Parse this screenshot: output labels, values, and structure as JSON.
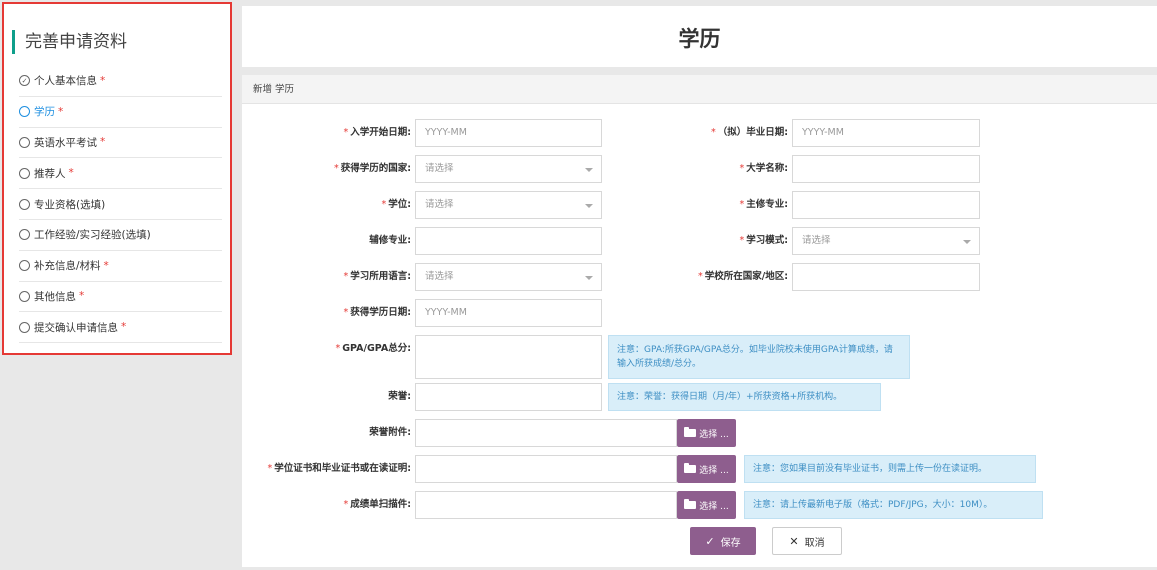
{
  "sidebar": {
    "title": "完善申请资料",
    "items": [
      {
        "label": "个人基本信息",
        "required": "*",
        "mark": "✓"
      },
      {
        "label": "学历",
        "required": "*",
        "mark": ""
      },
      {
        "label": "英语水平考试",
        "required": "*",
        "mark": ""
      },
      {
        "label": "推荐人",
        "required": "*",
        "mark": ""
      },
      {
        "label": "专业资格(选填)",
        "required": "",
        "mark": ""
      },
      {
        "label": "工作经验/实习经验(选填)",
        "required": "",
        "mark": ""
      },
      {
        "label": "补充信息/材料",
        "required": "*",
        "mark": ""
      },
      {
        "label": "其他信息",
        "required": "*",
        "mark": ""
      },
      {
        "label": "提交确认申请信息",
        "required": "*",
        "mark": ""
      }
    ]
  },
  "header": {
    "title": "学历"
  },
  "form": {
    "section_title": "新增 学历",
    "required_mark": "*",
    "fields": {
      "start_date": {
        "label": "入学开始日期:",
        "placeholder": "YYYY-MM"
      },
      "grad_date": {
        "label": "（拟）毕业日期:",
        "placeholder": "YYYY-MM"
      },
      "country": {
        "label": "获得学历的国家:",
        "value": "请选择"
      },
      "university": {
        "label": "大学名称:",
        "value": ""
      },
      "degree": {
        "label": "学位:",
        "value": "请选择"
      },
      "major": {
        "label": "主修专业:",
        "value": ""
      },
      "minor": {
        "label": "辅修专业:",
        "value": ""
      },
      "study_mode": {
        "label": "学习模式:",
        "value": "请选择"
      },
      "language": {
        "label": "学习所用语言:",
        "value": "请选择"
      },
      "school_region": {
        "label": "学校所在国家/地区:",
        "value": ""
      },
      "award_date": {
        "label": "获得学历日期:",
        "placeholder": "YYYY-MM"
      },
      "gpa": {
        "label": "GPA/GPA总分:",
        "value": ""
      },
      "honors": {
        "label": "荣誉:",
        "value": ""
      },
      "honors_attach": {
        "label": "荣誉附件:",
        "value": ""
      },
      "degree_cert": {
        "label": "学位证书和毕业证书或在读证明:",
        "value": ""
      },
      "transcript": {
        "label": "成绩单扫描件:",
        "value": ""
      }
    },
    "notes": {
      "gpa": "注意：GPA:所获GPA/GPA总分。如毕业院校未使用GPA计算成绩，请输入所获成绩/总分。",
      "honors": "注意：荣誉：获得日期（月/年）+所获资格+所获机构。",
      "degree_cert": "注意：您如果目前没有毕业证书，则需上传一份在读证明。",
      "transcript": "注意：请上传最新电子版（格式：PDF/JPG，大小：10M）。"
    },
    "pick_label": "选择 ...",
    "save_label": "保存",
    "cancel_label": "取消"
  },
  "colors": {
    "accent": "#0e9f8b",
    "active": "#1e8fe0",
    "required": "#e53935",
    "button": "#8e5e8e",
    "note_bg": "#d9eef9",
    "note_text": "#3e8fc4",
    "highlight_border": "#e53935"
  },
  "icons": {
    "folder": "folder-open-icon",
    "check": "check-icon",
    "close": "close-icon",
    "dropdown": "caret-down-icon"
  }
}
